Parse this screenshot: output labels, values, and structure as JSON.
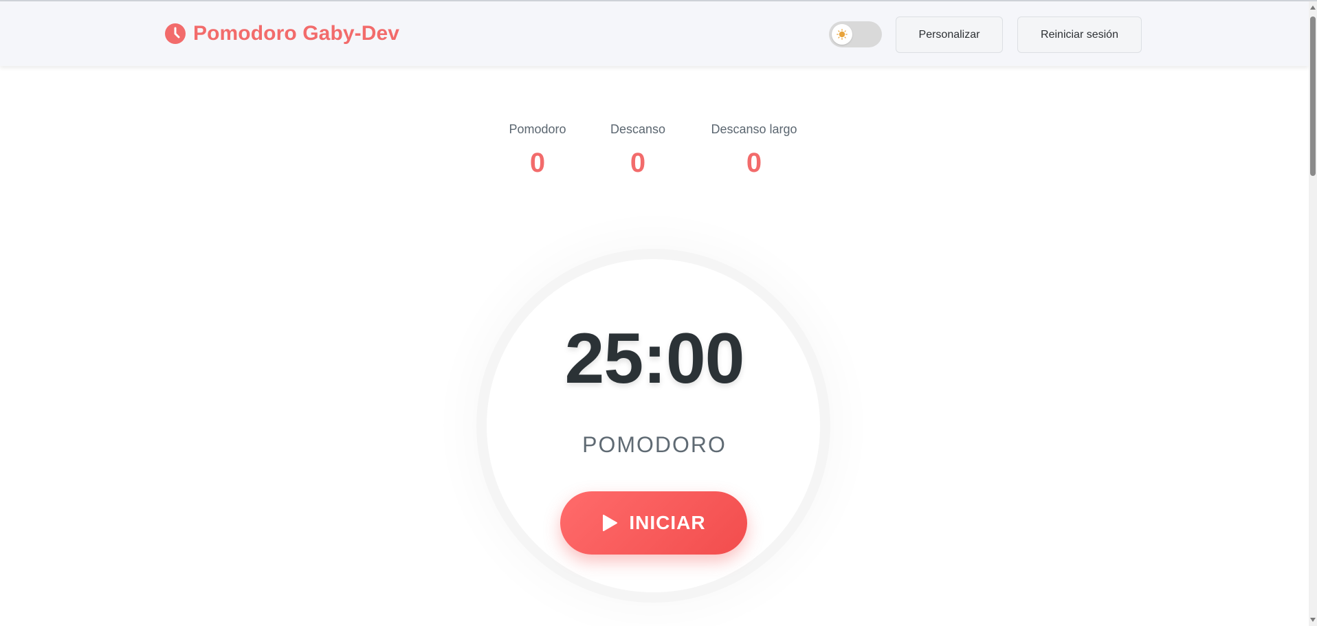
{
  "app": {
    "title": "Pomodoro Gaby-Dev",
    "brand_icon": "clock-icon",
    "accent_color": "#f26b6b"
  },
  "header": {
    "theme_toggle": {
      "state": "light",
      "icon": "sun-icon"
    },
    "customize_label": "Personalizar",
    "reset_label": "Reiniciar sesión"
  },
  "stats": [
    {
      "label": "Pomodoro",
      "value": "0"
    },
    {
      "label": "Descanso",
      "value": "0"
    },
    {
      "label": "Descanso largo",
      "value": "0"
    }
  ],
  "timer": {
    "time": "25:00",
    "mode": "POMODORO"
  },
  "start_button": {
    "label": "INICIAR",
    "icon": "play-icon"
  },
  "colors": {
    "header_bg": "#f5f6fa",
    "button_gradient_start": "#ff6b6b",
    "button_gradient_end": "#f24d4d",
    "time_text": "#2b3236"
  }
}
